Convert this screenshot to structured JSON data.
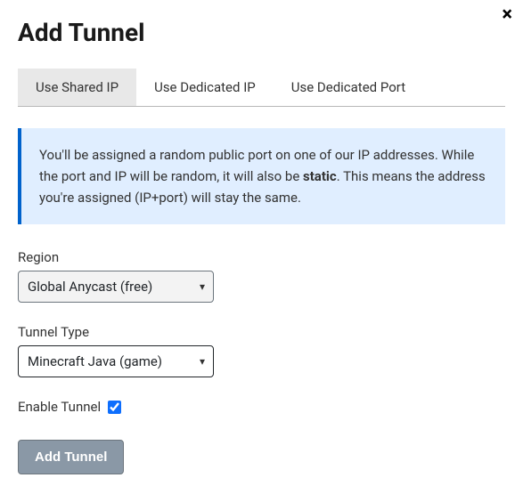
{
  "header": {
    "title": "Add Tunnel"
  },
  "tabs": [
    {
      "label": "Use Shared IP",
      "active": true
    },
    {
      "label": "Use Dedicated IP",
      "active": false
    },
    {
      "label": "Use Dedicated Port",
      "active": false
    }
  ],
  "info": {
    "part1": "You'll be assigned a random public port on one of our IP addresses. While the port and IP will be random, it will also be ",
    "bold": "static",
    "part2": ". This means the address you're assigned (IP+port) will stay the same."
  },
  "form": {
    "region": {
      "label": "Region",
      "value": "Global Anycast (free)"
    },
    "tunnel_type": {
      "label": "Tunnel Type",
      "value": "Minecraft Java (game)"
    },
    "enable": {
      "label": "Enable Tunnel"
    },
    "submit_label": "Add Tunnel"
  }
}
